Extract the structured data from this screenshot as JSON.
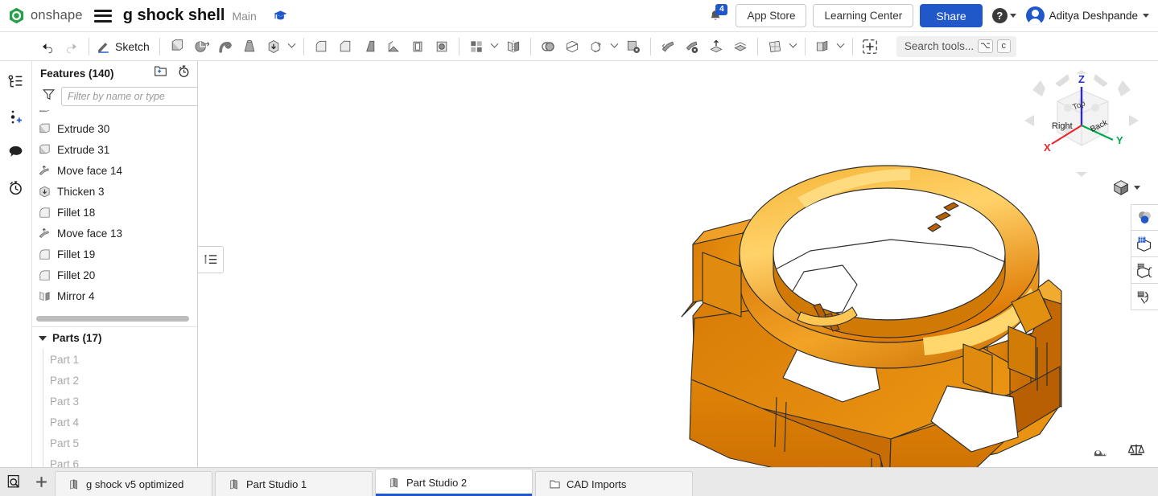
{
  "header": {
    "brand": "onshape",
    "menu_icon": "hamburger-icon",
    "document_title": "g shock shell",
    "branch": "Main",
    "learning_icon": "graduation-cap-icon",
    "notifications": {
      "icon": "bell-icon",
      "count": "4"
    },
    "app_store_label": "App Store",
    "learning_center_label": "Learning Center",
    "share_label": "Share",
    "help_label": "?",
    "user_name": "Aditya Deshpande",
    "accent_color": "#2158c9"
  },
  "toolbar": {
    "undo": "undo-icon",
    "redo": "redo-icon",
    "sketch_label": "Sketch",
    "items": [
      {
        "name": "extrude-icon"
      },
      {
        "name": "revolve-icon"
      },
      {
        "name": "sweep-icon"
      },
      {
        "name": "loft-icon"
      },
      {
        "name": "thicken-icon"
      },
      {
        "name": "fillet-icon"
      },
      {
        "name": "chamfer-icon"
      },
      {
        "name": "draft-icon"
      },
      {
        "name": "rib-icon"
      },
      {
        "name": "shell-icon"
      },
      {
        "name": "hole-icon"
      },
      {
        "name": "pattern-icon"
      },
      {
        "name": "mirror-icon"
      },
      {
        "name": "boolean-icon"
      },
      {
        "name": "split-icon"
      },
      {
        "name": "transform-icon"
      },
      {
        "name": "delete-part-icon"
      },
      {
        "name": "move-face-icon"
      },
      {
        "name": "delete-face-icon"
      },
      {
        "name": "replace-face-icon"
      },
      {
        "name": "offset-surface-icon"
      },
      {
        "name": "plane-icon"
      },
      {
        "name": "sheet-metal-icon"
      },
      {
        "name": "insert-feature-icon"
      }
    ],
    "search_placeholder": "Search tools...",
    "search_shortcut_mod": "⌥",
    "search_shortcut_key": "c"
  },
  "left_rail": [
    {
      "name": "feature-list-icon"
    },
    {
      "name": "add-branch-icon"
    },
    {
      "name": "comments-icon"
    },
    {
      "name": "history-icon"
    }
  ],
  "feature_panel": {
    "title": "Features (140)",
    "new_folder_icon": "new-folder-icon",
    "rollback_icon": "rollback-timer-icon",
    "filter_icon": "filter-funnel-icon",
    "filter_placeholder": "Filter by name or type",
    "features": [
      {
        "label": "Extrude 30",
        "icon": "extrude-icon"
      },
      {
        "label": "Extrude 31",
        "icon": "extrude-icon"
      },
      {
        "label": "Move face 14",
        "icon": "move-face-icon"
      },
      {
        "label": "Thicken 3",
        "icon": "thicken-icon"
      },
      {
        "label": "Fillet 18",
        "icon": "fillet-icon"
      },
      {
        "label": "Move face 13",
        "icon": "move-face-icon"
      },
      {
        "label": "Fillet 19",
        "icon": "fillet-icon"
      },
      {
        "label": "Fillet 20",
        "icon": "fillet-icon"
      },
      {
        "label": "Mirror 4",
        "icon": "mirror-icon"
      }
    ],
    "parts_title": "Parts (17)",
    "parts": [
      {
        "label": "Part 1"
      },
      {
        "label": "Part 2"
      },
      {
        "label": "Part 3"
      },
      {
        "label": "Part 4"
      },
      {
        "label": "Part 5"
      },
      {
        "label": "Part 6"
      }
    ],
    "panel_handle_icon": "collapse-tree-icon"
  },
  "viewport": {
    "model_name": "g-shock-shell-bezel",
    "model_color": "#e58a10",
    "view_cube": {
      "face_front": "Right",
      "face_right": "Back",
      "face_top": "Top",
      "axis_x": "X",
      "axis_y": "Y",
      "axis_z": "Z",
      "color_x": "#e8272c",
      "color_y": "#00a94f",
      "color_z": "#2b2bd6"
    },
    "display_mode_icon": "shaded-cube-icon",
    "tools": [
      {
        "name": "measure-icon"
      },
      {
        "name": "mass-properties-icon"
      }
    ]
  },
  "right_rail": [
    {
      "name": "appearance-icon"
    },
    {
      "name": "display-state-icon"
    },
    {
      "name": "section-view-icon"
    },
    {
      "name": "render-icon"
    }
  ],
  "tabbar": {
    "search_tabs_icon": "search-tabs-icon",
    "add_tab_icon": "add-tab-icon",
    "tabs": [
      {
        "label": "g shock v5 optimized",
        "icon": "part-studio-icon",
        "active": false
      },
      {
        "label": "Part Studio 1",
        "icon": "part-studio-icon",
        "active": false
      },
      {
        "label": "Part Studio 2",
        "icon": "part-studio-icon",
        "active": true
      },
      {
        "label": "CAD Imports",
        "icon": "folder-icon",
        "active": false
      }
    ]
  }
}
